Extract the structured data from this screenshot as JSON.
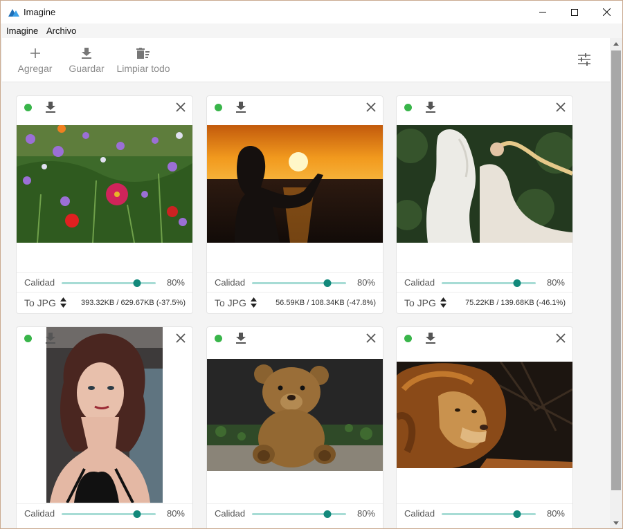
{
  "window": {
    "title": "Imagine",
    "accent": "#12897b",
    "status_color": "#39b54a"
  },
  "menu": [
    "Imagine",
    "Archivo"
  ],
  "toolbar": {
    "add_label": "Agregar",
    "save_label": "Guardar",
    "clear_label": "Limpiar todo",
    "settings_icon": "sliders-icon"
  },
  "cards": [
    {
      "subject": "flowers",
      "quality_label": "Calidad",
      "quality": 80,
      "quality_text": "80%",
      "format": "To JPG",
      "sizes": "393.32KB / 629.67KB (-37.5%)"
    },
    {
      "subject": "sunset",
      "quality_label": "Calidad",
      "quality": 80,
      "quality_text": "80%",
      "format": "To JPG",
      "sizes": "56.59KB / 108.34KB (-47.8%)"
    },
    {
      "subject": "horse",
      "quality_label": "Calidad",
      "quality": 80,
      "quality_text": "80%",
      "format": "To JPG",
      "sizes": "75.22KB / 139.68KB (-46.1%)"
    },
    {
      "subject": "portrait",
      "quality_label": "Calidad",
      "quality": 80,
      "quality_text": "80%"
    },
    {
      "subject": "teddy-bear",
      "quality_label": "Calidad",
      "quality": 80,
      "quality_text": "80%"
    },
    {
      "subject": "lion",
      "quality_label": "Calidad",
      "quality": 80,
      "quality_text": "80%"
    }
  ]
}
